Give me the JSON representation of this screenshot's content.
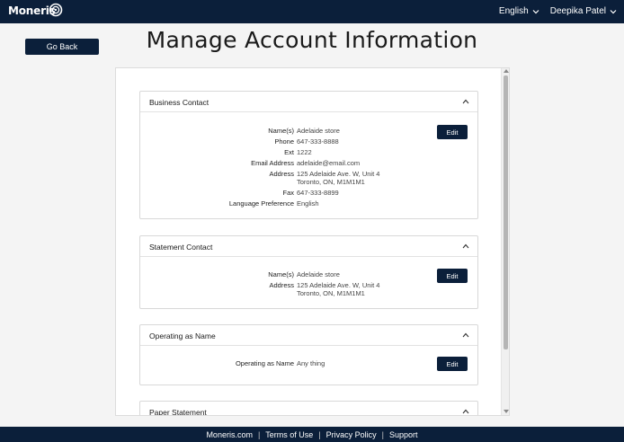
{
  "header": {
    "brand": "Moneris",
    "language": "English",
    "user": "Deepika Patel"
  },
  "page": {
    "go_back": "Go Back",
    "title": "Manage Account Information"
  },
  "sections": {
    "business": {
      "title": "Business Contact",
      "edit": "Edit",
      "fields": {
        "name_label": "Name(s)",
        "name_value": "Adelaide store",
        "phone_label": "Phone",
        "phone_value": "647-333-8888",
        "ext_label": "Ext",
        "ext_value": "1222",
        "email_label": "Email Address",
        "email_value": "adelaide@email.com",
        "address_label": "Address",
        "address_line1": "125 Adelaide Ave. W, Unit 4",
        "address_line2": "Toronto, ON, M1M1M1",
        "fax_label": "Fax",
        "fax_value": "647-333-8899",
        "lang_label": "Language Preference",
        "lang_value": "English"
      }
    },
    "statement": {
      "title": "Statement Contact",
      "edit": "Edit",
      "fields": {
        "name_label": "Name(s)",
        "name_value": "Adelaide store",
        "address_label": "Address",
        "address_line1": "125 Adelaide Ave. W, Unit 4",
        "address_line2": "Toronto, ON, M1M1M1"
      }
    },
    "operating": {
      "title": "Operating as Name",
      "edit": "Edit",
      "fields": {
        "op_label": "Operating as Name",
        "op_value": "Any thing"
      }
    },
    "paper": {
      "title": "Paper Statement"
    }
  },
  "footer": {
    "links": [
      "Moneris.com",
      "Terms of Use",
      "Privacy Policy",
      "Support"
    ],
    "separator": "|"
  },
  "colors": {
    "navy": "#0b1f3a",
    "background": "#f4f4f4"
  }
}
